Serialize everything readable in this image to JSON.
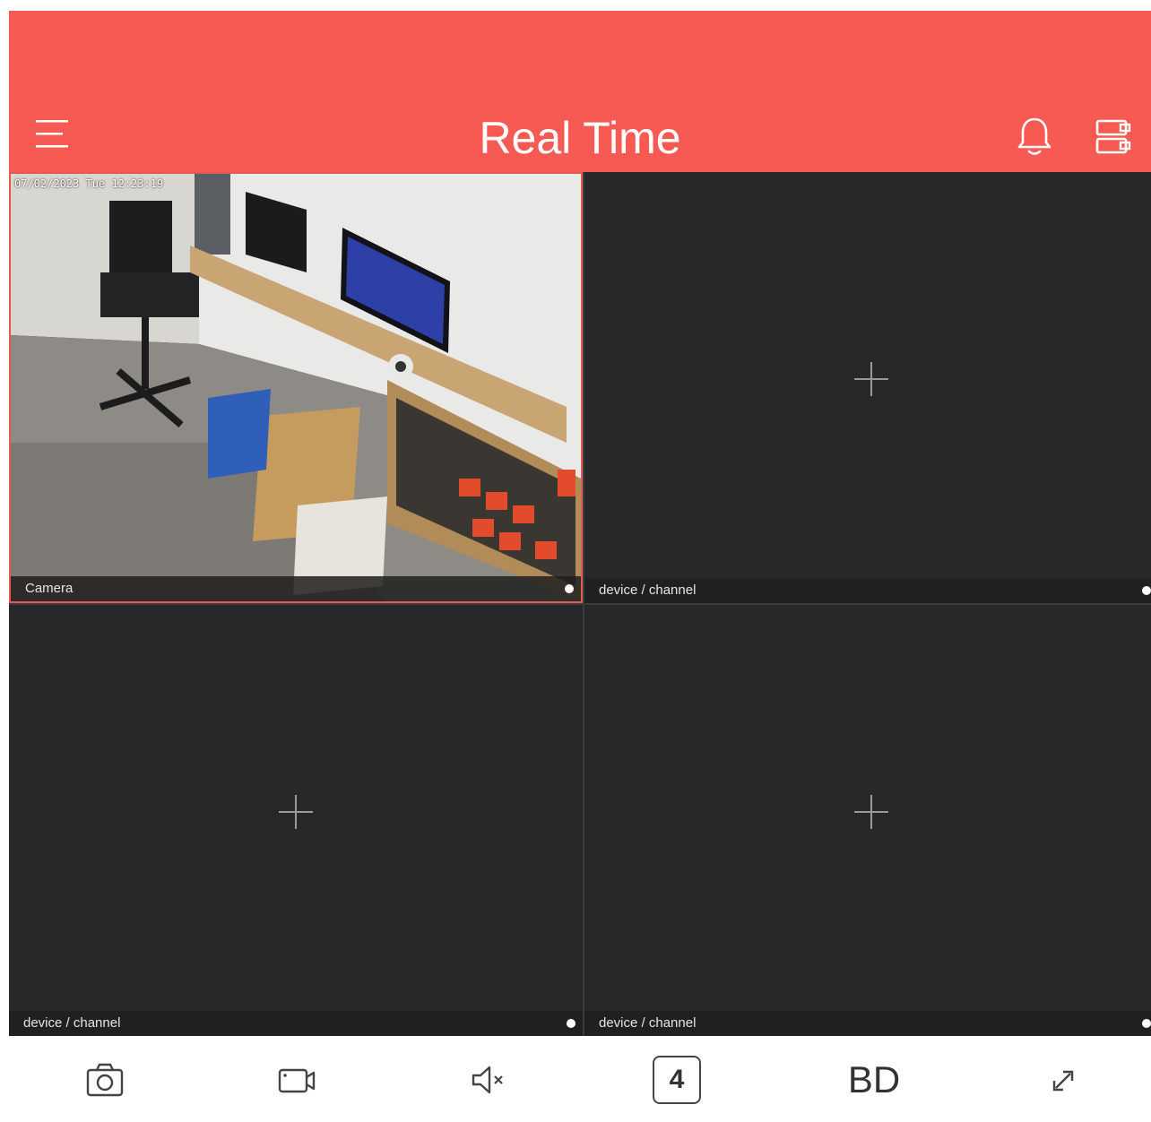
{
  "header": {
    "title": "Real Time",
    "background_color": "#f65a52",
    "menu_icon": "menu-icon",
    "alarm_icon": "bell-icon",
    "device_icon": "device-list-icon"
  },
  "grid": {
    "cells": [
      {
        "label": "Camera",
        "timestamp": "07/02/2023 Tue 12:23:19",
        "state": "live",
        "selected": true
      },
      {
        "label": "device / channel",
        "state": "empty"
      },
      {
        "label": "device / channel",
        "state": "empty"
      },
      {
        "label": "device / channel",
        "state": "empty"
      }
    ]
  },
  "toolbar": {
    "snapshot_icon": "camera-icon",
    "record_icon": "video-record-icon",
    "audio_icon": "mute-icon",
    "split_count": "4",
    "stream_quality": "BD",
    "fullscreen_icon": "expand-icon"
  }
}
